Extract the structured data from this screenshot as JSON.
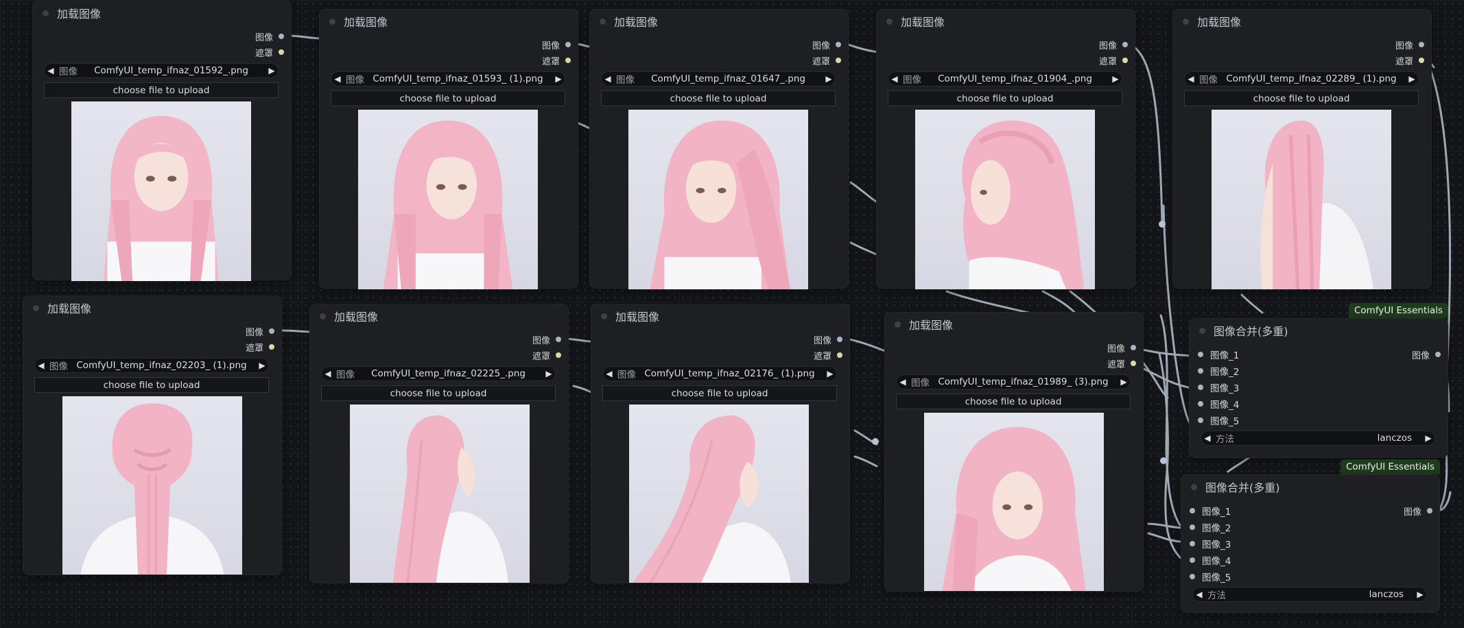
{
  "load_nodes": [
    {
      "title": "加载图像",
      "out_image": "图像",
      "out_mask": "遮罩",
      "widget_label": "图像",
      "filename": "ComfyUI_temp_ifnaz_01592_.png",
      "upload": "choose file to upload"
    },
    {
      "title": "加载图像",
      "out_image": "图像",
      "out_mask": "遮罩",
      "widget_label": "图像",
      "filename": "ComfyUI_temp_ifnaz_01593_ (1).png",
      "upload": "choose file to upload"
    },
    {
      "title": "加载图像",
      "out_image": "图像",
      "out_mask": "遮罩",
      "widget_label": "图像",
      "filename": "ComfyUI_temp_ifnaz_01647_.png",
      "upload": "choose file to upload"
    },
    {
      "title": "加载图像",
      "out_image": "图像",
      "out_mask": "遮罩",
      "widget_label": "图像",
      "filename": "ComfyUI_temp_ifnaz_01904_.png",
      "upload": "choose file to upload"
    },
    {
      "title": "加载图像",
      "out_image": "图像",
      "out_mask": "遮罩",
      "widget_label": "图像",
      "filename": "ComfyUI_temp_ifnaz_02289_ (1).png",
      "upload": "choose file to upload"
    },
    {
      "title": "加载图像",
      "out_image": "图像",
      "out_mask": "遮罩",
      "widget_label": "图像",
      "filename": "ComfyUI_temp_ifnaz_02203_ (1).png",
      "upload": "choose file to upload"
    },
    {
      "title": "加载图像",
      "out_image": "图像",
      "out_mask": "遮罩",
      "widget_label": "图像",
      "filename": "ComfyUI_temp_ifnaz_02225_.png",
      "upload": "choose file to upload"
    },
    {
      "title": "加载图像",
      "out_image": "图像",
      "out_mask": "遮罩",
      "widget_label": "图像",
      "filename": "ComfyUI_temp_ifnaz_02176_ (1).png",
      "upload": "choose file to upload"
    },
    {
      "title": "加载图像",
      "out_image": "图像",
      "out_mask": "遮罩",
      "widget_label": "图像",
      "filename": "ComfyUI_temp_ifnaz_01989_ (3).png",
      "upload": "choose file to upload"
    }
  ],
  "merge_nodes": [
    {
      "badge": "ComfyUI Essentials",
      "title": "图像合并(多重)",
      "inputs": [
        "图像_1",
        "图像_2",
        "图像_3",
        "图像_4",
        "图像_5"
      ],
      "output": "图像",
      "method_label": "方法",
      "method_value": "lanczos"
    },
    {
      "badge": "ComfyUI Essentials",
      "title": "图像合并(多重)",
      "inputs": [
        "图像_1",
        "图像_2",
        "图像_3",
        "图像_4",
        "图像_5"
      ],
      "output": "图像",
      "method_label": "方法",
      "method_value": "lanczos"
    }
  ],
  "colors": {
    "canvas": "#141518",
    "node": "#1e1f23",
    "link": "#b7c3d2",
    "image_socket": "#a8b5c6",
    "mask_socket": "#d8d9a4",
    "badge": "#1f3a1c"
  },
  "icons": [
    "collapse-dot-icon",
    "arrow-left-icon",
    "arrow-right-icon",
    "socket-icon"
  ]
}
